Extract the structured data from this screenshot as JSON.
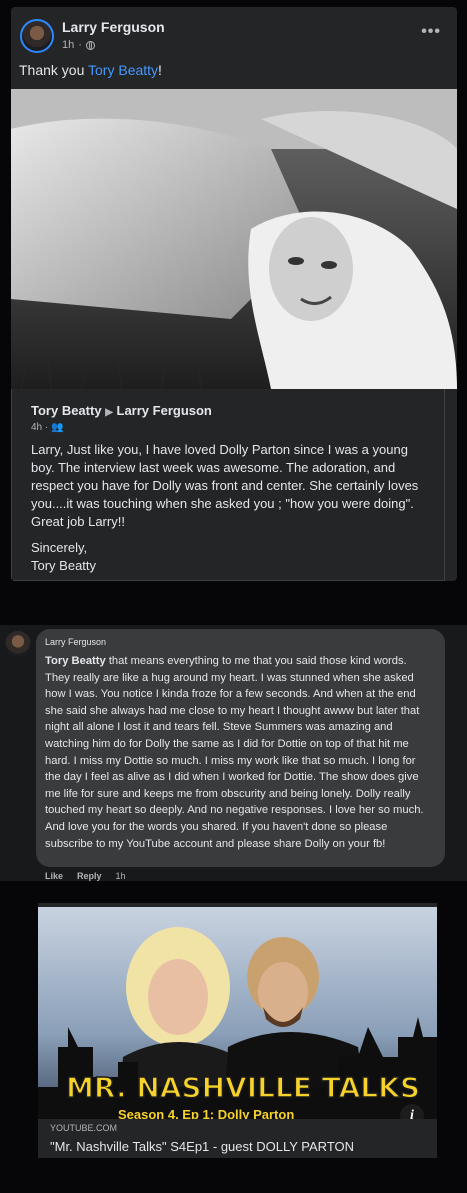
{
  "post": {
    "author": "Larry Ferguson",
    "time": "1h",
    "text_prefix": "Thank you ",
    "mention": "Tory Beatty",
    "text_suffix": "!",
    "more_label": "•••"
  },
  "shared_post": {
    "author": "Tory Beatty",
    "target": "Larry Ferguson",
    "time": "4h",
    "paragraphs": [
      "Larry, Just like you, I have loved Dolly Parton since I was a young boy. The interview last week was awesome.  The adoration, and respect you have for Dolly was front and center.  She certainly loves you....it was touching when she asked  you ; \"how you were doing\". Great job Larry!!"
    ],
    "signoff": "Sincerely,",
    "signature": "Tory Beatty"
  },
  "comment": {
    "author": "Larry Ferguson",
    "mention": "Tory Beatty",
    "text": " that means everything to me that you said those kind words. They really are like a hug around my heart. I was stunned when she asked how I was. You notice I kinda froze for a few seconds. And when at the end she said she always had me close to my heart I thought awww but later that night all alone I lost it and tears fell. Steve Summers was amazing and watching him do for Dolly the same as I did for Dottie on top of that hit me hard. I miss my Dottie so much. I miss my work like that so much. I long for the day I feel as alive as I did when I worked for Dottie. The show does give me life for sure and keeps me from obscurity and being lonely. Dolly really touched my heart so deeply. And no negative responses. I love her so much. And love you for the words you shared. If you haven't done so please subscribe to my YouTube account and please share Dolly on your fb!",
    "like_label": "Like",
    "reply_label": "Reply",
    "time": "1h"
  },
  "link_preview": {
    "banner": "MR. NASHVILLE TALKS",
    "subtitle": "Season 4, Ep 1: Dolly Parton",
    "domain": "YOUTUBE.COM",
    "title": "\"Mr. Nashville Talks\" S4Ep1 - guest DOLLY PARTON",
    "info_icon": "i"
  }
}
